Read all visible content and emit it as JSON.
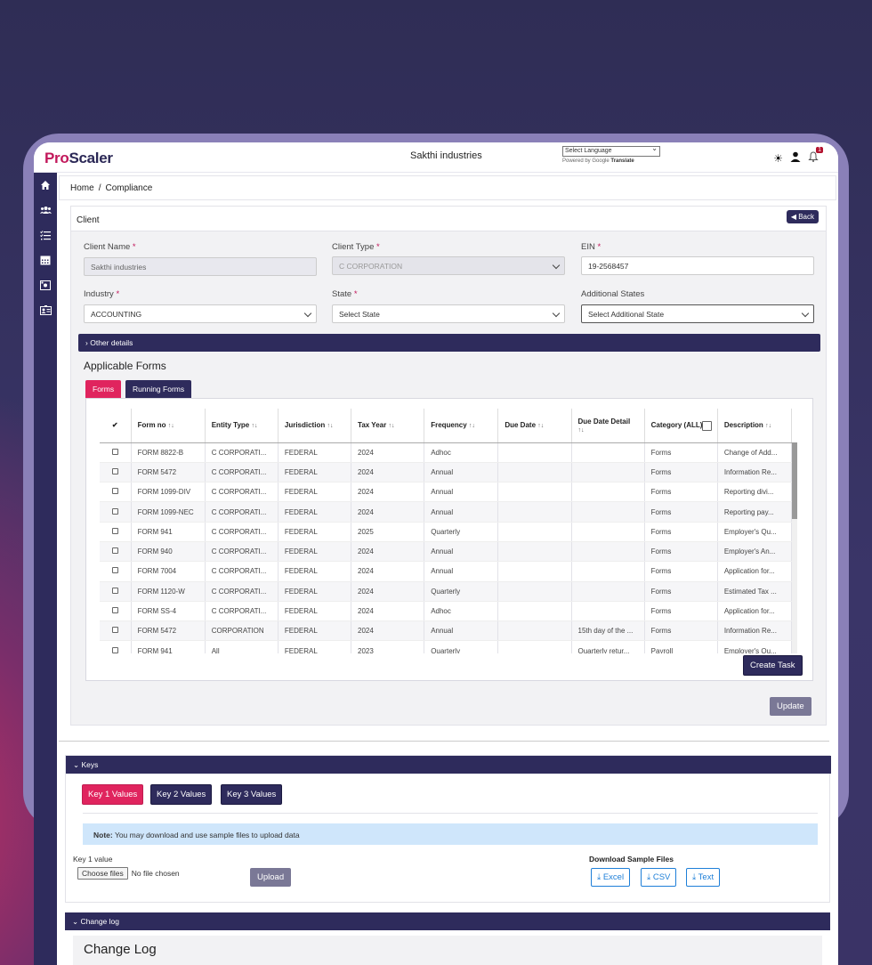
{
  "header": {
    "logo_pro": "Pro",
    "logo_scaler": "Scaler",
    "company": "Sakthi industries",
    "language_select": "Select Language",
    "powered_by": "Powered by",
    "google": "Google",
    "translate": "Translate",
    "notification_count": "1"
  },
  "sidebar": {
    "items": [
      "home-icon",
      "users-icon",
      "tasks-icon",
      "calendar-icon",
      "money-icon",
      "id-card-icon"
    ]
  },
  "breadcrumb": {
    "home": "Home",
    "separator": "/",
    "current": "Compliance"
  },
  "client": {
    "title": "Client",
    "back": "Back",
    "client_name_label": "Client Name",
    "client_name_value": "Sakthi industries",
    "client_type_label": "Client Type",
    "client_type_value": "C CORPORATION",
    "ein_label": "EIN",
    "ein_value": "19-2568457",
    "industry_label": "Industry",
    "industry_value": "ACCOUNTING",
    "state_label": "State",
    "state_value": "Select State",
    "additional_states_label": "Additional States",
    "additional_states_value": "Select Additional State",
    "required_mark": "*",
    "other_details": "Other details",
    "applicable_forms": "Applicable Forms",
    "tabs": [
      "Forms",
      "Running Forms"
    ],
    "create_task": "Create Task",
    "update": "Update"
  },
  "table": {
    "check_header": "✔",
    "columns": [
      "Form no",
      "Entity Type",
      "Jurisdiction",
      "Tax Year",
      "Frequency",
      "Due Date",
      "Due Date Detail",
      "Category (ALL)",
      "Description"
    ],
    "rows": [
      [
        "FORM 8822-B",
        "C CORPORATI...",
        "FEDERAL",
        "2024",
        "Adhoc",
        "",
        "",
        "Forms",
        "Change of Add..."
      ],
      [
        "FORM 5472",
        "C CORPORATI...",
        "FEDERAL",
        "2024",
        "Annual",
        "",
        "",
        "Forms",
        "Information Re..."
      ],
      [
        "FORM 1099-DIV",
        "C CORPORATI...",
        "FEDERAL",
        "2024",
        "Annual",
        "",
        "",
        "Forms",
        "Reporting divi..."
      ],
      [
        "FORM 1099-NEC",
        "C CORPORATI...",
        "FEDERAL",
        "2024",
        "Annual",
        "",
        "",
        "Forms",
        "Reporting pay..."
      ],
      [
        "FORM 941",
        "C CORPORATI...",
        "FEDERAL",
        "2025",
        "Quarterly",
        "",
        "",
        "Forms",
        "Employer's Qu..."
      ],
      [
        "FORM 940",
        "C CORPORATI...",
        "FEDERAL",
        "2024",
        "Annual",
        "",
        "",
        "Forms",
        "Employer's An..."
      ],
      [
        "FORM 7004",
        "C CORPORATI...",
        "FEDERAL",
        "2024",
        "Annual",
        "",
        "",
        "Forms",
        "Application for..."
      ],
      [
        "FORM 1120-W",
        "C CORPORATI...",
        "FEDERAL",
        "2024",
        "Quarterly",
        "",
        "",
        "Forms",
        "Estimated Tax ..."
      ],
      [
        "FORM SS-4",
        "C CORPORATI...",
        "FEDERAL",
        "2024",
        "Adhoc",
        "",
        "",
        "Forms",
        "Application for..."
      ],
      [
        "FORM 5472",
        "CORPORATION",
        "FEDERAL",
        "2024",
        "Annual",
        "",
        "15th day of the ...",
        "Forms",
        "Information Re..."
      ],
      [
        "FORM 941",
        "All",
        "FEDERAL",
        "2023",
        "Quarterly",
        "",
        "Quarterly retur...",
        "Payroll",
        "Employer's Qu..."
      ]
    ]
  },
  "keys": {
    "title": "Keys",
    "buttons": [
      "Key 1 Values",
      "Key 2 Values",
      "Key 3 Values"
    ],
    "note_bold": "Note:",
    "note_text": " You may download and use sample files to upload data",
    "key_label": "Key 1 value",
    "choose_files": "Choose files",
    "no_file": "No file chosen",
    "upload": "Upload",
    "download_title": "Download Sample Files",
    "downloads": [
      "Excel",
      "CSV",
      "Text"
    ]
  },
  "changelog": {
    "bar": "Change log",
    "title": "Change Log"
  },
  "colors": {
    "primary": "#2e2b5c",
    "accent": "#e0245e",
    "info": "#cfe6fb",
    "link": "#1e7fd8"
  }
}
